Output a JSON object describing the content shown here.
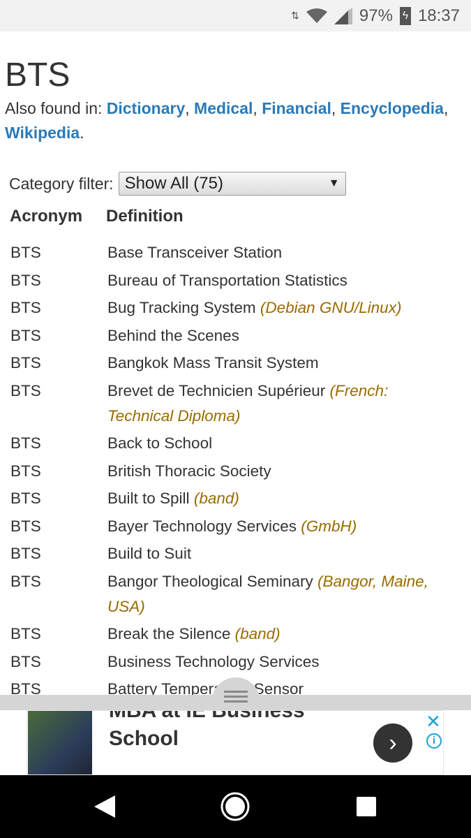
{
  "status_bar": {
    "battery": "97%",
    "time": "18:37"
  },
  "page": {
    "title": "BTS",
    "also_found_label": "Also found in:",
    "also_links": [
      "Dictionary",
      "Medical",
      "Financial",
      "Encyclopedia",
      "Wikipedia"
    ]
  },
  "filter": {
    "label": "Category filter:",
    "value": "Show All (75)"
  },
  "table": {
    "headers": [
      "Acronym",
      "Definition"
    ],
    "rows": [
      {
        "acronym": "BTS",
        "definition": "Base Transceiver Station",
        "note": ""
      },
      {
        "acronym": "BTS",
        "definition": "Bureau of Transportation Statistics",
        "note": ""
      },
      {
        "acronym": "BTS",
        "definition": "Bug Tracking System",
        "note": "(Debian GNU/Linux)"
      },
      {
        "acronym": "BTS",
        "definition": "Behind the Scenes",
        "note": ""
      },
      {
        "acronym": "BTS",
        "definition": "Bangkok Mass Transit System",
        "note": ""
      },
      {
        "acronym": "BTS",
        "definition": "Brevet de Technicien Supérieur",
        "note": "(French: Technical Diploma)"
      },
      {
        "acronym": "BTS",
        "definition": "Back to School",
        "note": ""
      },
      {
        "acronym": "BTS",
        "definition": "British Thoracic Society",
        "note": ""
      },
      {
        "acronym": "BTS",
        "definition": "Built to Spill",
        "note": "(band)"
      },
      {
        "acronym": "BTS",
        "definition": "Bayer Technology Services",
        "note": "(GmbH)"
      },
      {
        "acronym": "BTS",
        "definition": "Build to Suit",
        "note": ""
      },
      {
        "acronym": "BTS",
        "definition": "Bangor Theological Seminary",
        "note": "(Bangor, Maine, USA)"
      },
      {
        "acronym": "BTS",
        "definition": "Break the Silence",
        "note": "(band)"
      },
      {
        "acronym": "BTS",
        "definition": "Business Technology Services",
        "note": ""
      },
      {
        "acronym": "BTS",
        "definition": "Battery Temperature Sensor",
        "note": ""
      }
    ]
  },
  "ad": {
    "headline": "MBA at IE Business School",
    "close": "✕",
    "info": "i",
    "next": "›"
  }
}
